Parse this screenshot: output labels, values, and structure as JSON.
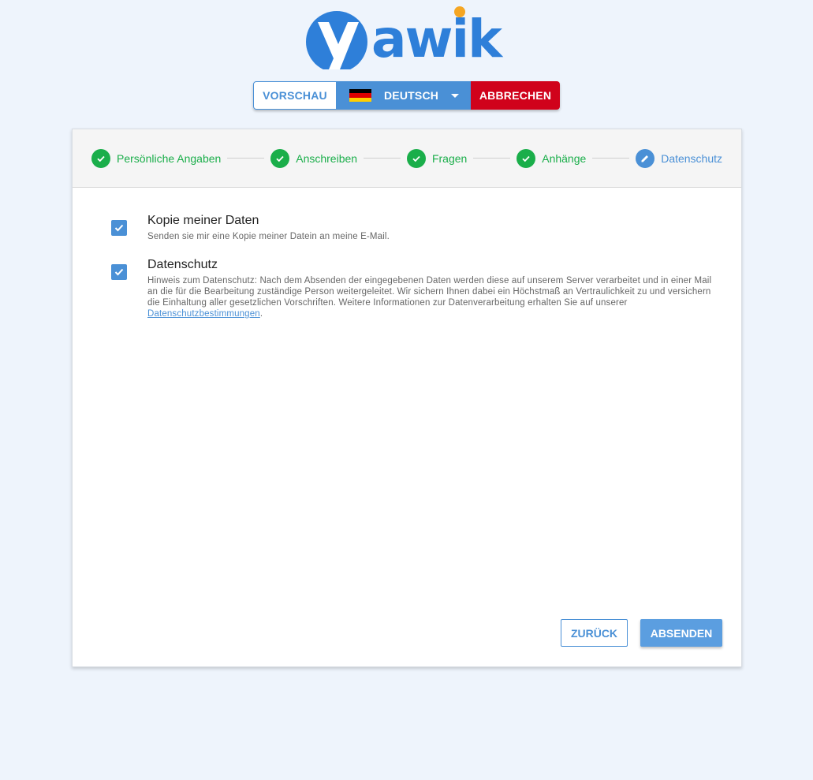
{
  "logo": {
    "text": "yawik"
  },
  "toolbar": {
    "preview_label": "VORSCHAU",
    "language_label": "DEUTSCH",
    "cancel_label": "ABBRECHEN"
  },
  "stepper": {
    "steps": [
      {
        "label": "Persönliche Angaben",
        "state": "done"
      },
      {
        "label": "Anschreiben",
        "state": "done"
      },
      {
        "label": "Fragen",
        "state": "done"
      },
      {
        "label": "Anhänge",
        "state": "done"
      },
      {
        "label": "Datenschutz",
        "state": "active"
      }
    ]
  },
  "consents": [
    {
      "title": "Kopie meiner Daten",
      "description": "Senden sie mir eine Kopie meiner Datein an meine E-Mail.",
      "checked": true
    },
    {
      "title": "Datenschutz",
      "description": "Hinweis zum Datenschutz: Nach dem Absenden der eingegebenen Daten werden diese auf unserem Server verarbeitet und in einer Mail an die für die Bearbeitung zuständige Person weitergeleitet. Wir sichern Ihnen dabei ein Höchstmaß an Vertraulichkeit zu und versichern die Einhaltung aller gesetzlichen Vorschriften. Weitere Informationen zur Datenverarbeitung erhalten Sie auf unserer",
      "link_text": "Datenschutzbestimmungen",
      "suffix": ".",
      "checked": true
    }
  ],
  "actions": {
    "back_label": "ZURÜCK",
    "submit_label": "ABSENDEN"
  },
  "colors": {
    "primary": "#4a90d6",
    "success": "#1aae4a",
    "danger": "#d0021b",
    "logo_dot": "#f5a623",
    "background": "#eef4fc"
  },
  "icons": {
    "step_done": "check-icon",
    "step_active": "pencil-icon",
    "checkbox": "checkbox-checked-icon",
    "language": "german-flag-icon",
    "dropdown": "caret-down-icon"
  }
}
